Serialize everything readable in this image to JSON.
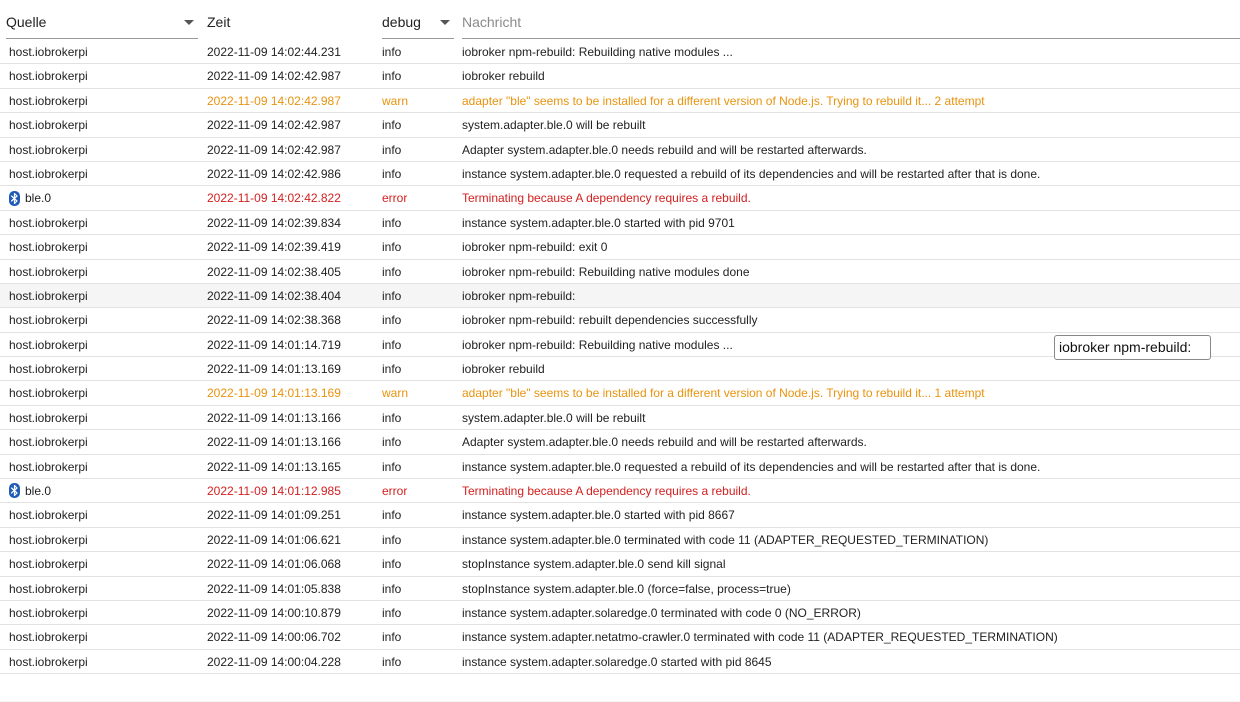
{
  "header": {
    "source_label": "Quelle",
    "time_label": "Zeit",
    "severity_label": "debug",
    "message_placeholder": "Nachricht"
  },
  "colors": {
    "warn": "#e8930e",
    "error": "#d32020",
    "bluetooth": "#1f5db8"
  },
  "rows": [
    {
      "source": "host.iobrokerpi",
      "time": "2022-11-09 14:02:44.231",
      "severity": "info",
      "message": "iobroker npm-rebuild: Rebuilding native modules ..."
    },
    {
      "source": "host.iobrokerpi",
      "time": "2022-11-09 14:02:42.987",
      "severity": "info",
      "message": "iobroker rebuild"
    },
    {
      "source": "host.iobrokerpi",
      "time": "2022-11-09 14:02:42.987",
      "severity": "warn",
      "message": "adapter \"ble\" seems to be installed for a different version of Node.js. Trying to rebuild it... 2 attempt"
    },
    {
      "source": "host.iobrokerpi",
      "time": "2022-11-09 14:02:42.987",
      "severity": "info",
      "message": "system.adapter.ble.0 will be rebuilt"
    },
    {
      "source": "host.iobrokerpi",
      "time": "2022-11-09 14:02:42.987",
      "severity": "info",
      "message": "Adapter system.adapter.ble.0 needs rebuild and will be restarted afterwards."
    },
    {
      "source": "host.iobrokerpi",
      "time": "2022-11-09 14:02:42.986",
      "severity": "info",
      "message": "instance system.adapter.ble.0 requested a rebuild of its dependencies and will be restarted after that is done."
    },
    {
      "source": "ble.0",
      "icon": "bluetooth-icon",
      "time": "2022-11-09 14:02:42.822",
      "severity": "error",
      "message": "Terminating because A dependency requires a rebuild."
    },
    {
      "source": "host.iobrokerpi",
      "time": "2022-11-09 14:02:39.834",
      "severity": "info",
      "message": "instance system.adapter.ble.0 started with pid 9701"
    },
    {
      "source": "host.iobrokerpi",
      "time": "2022-11-09 14:02:39.419",
      "severity": "info",
      "message": "iobroker npm-rebuild: exit 0"
    },
    {
      "source": "host.iobrokerpi",
      "time": "2022-11-09 14:02:38.405",
      "severity": "info",
      "message": "iobroker npm-rebuild: Rebuilding native modules done"
    },
    {
      "source": "host.iobrokerpi",
      "time": "2022-11-09 14:02:38.404",
      "severity": "info",
      "message": "iobroker npm-rebuild:",
      "hover": true
    },
    {
      "source": "host.iobrokerpi",
      "time": "2022-11-09 14:02:38.368",
      "severity": "info",
      "message": "iobroker npm-rebuild: rebuilt dependencies successfully"
    },
    {
      "source": "host.iobrokerpi",
      "time": "2022-11-09 14:01:14.719",
      "severity": "info",
      "message": "iobroker npm-rebuild: Rebuilding native modules ..."
    },
    {
      "source": "host.iobrokerpi",
      "time": "2022-11-09 14:01:13.169",
      "severity": "info",
      "message": "iobroker rebuild"
    },
    {
      "source": "host.iobrokerpi",
      "time": "2022-11-09 14:01:13.169",
      "severity": "warn",
      "message": "adapter \"ble\" seems to be installed for a different version of Node.js. Trying to rebuild it... 1 attempt"
    },
    {
      "source": "host.iobrokerpi",
      "time": "2022-11-09 14:01:13.166",
      "severity": "info",
      "message": "system.adapter.ble.0 will be rebuilt"
    },
    {
      "source": "host.iobrokerpi",
      "time": "2022-11-09 14:01:13.166",
      "severity": "info",
      "message": "Adapter system.adapter.ble.0 needs rebuild and will be restarted afterwards."
    },
    {
      "source": "host.iobrokerpi",
      "time": "2022-11-09 14:01:13.165",
      "severity": "info",
      "message": "instance system.adapter.ble.0 requested a rebuild of its dependencies and will be restarted after that is done."
    },
    {
      "source": "ble.0",
      "icon": "bluetooth-icon",
      "time": "2022-11-09 14:01:12.985",
      "severity": "error",
      "message": "Terminating because A dependency requires a rebuild."
    },
    {
      "source": "host.iobrokerpi",
      "time": "2022-11-09 14:01:09.251",
      "severity": "info",
      "message": "instance system.adapter.ble.0 started with pid 8667"
    },
    {
      "source": "host.iobrokerpi",
      "time": "2022-11-09 14:01:06.621",
      "severity": "info",
      "message": "instance system.adapter.ble.0 terminated with code 11 (ADAPTER_REQUESTED_TERMINATION)"
    },
    {
      "source": "host.iobrokerpi",
      "time": "2022-11-09 14:01:06.068",
      "severity": "info",
      "message": "stopInstance system.adapter.ble.0 send kill signal"
    },
    {
      "source": "host.iobrokerpi",
      "time": "2022-11-09 14:01:05.838",
      "severity": "info",
      "message": "stopInstance system.adapter.ble.0 (force=false, process=true)"
    },
    {
      "source": "host.iobrokerpi",
      "time": "2022-11-09 14:00:10.879",
      "severity": "info",
      "message": "instance system.adapter.solaredge.0 terminated with code 0 (NO_ERROR)"
    },
    {
      "source": "host.iobrokerpi",
      "time": "2022-11-09 14:00:06.702",
      "severity": "info",
      "message": "instance system.adapter.netatmo-crawler.0 terminated with code 11 (ADAPTER_REQUESTED_TERMINATION)"
    },
    {
      "source": "host.iobrokerpi",
      "time": "2022-11-09 14:00:04.228",
      "severity": "info",
      "message": "instance system.adapter.solaredge.0 started with pid 8645"
    }
  ],
  "tooltip": {
    "text": "iobroker npm-rebuild:"
  }
}
